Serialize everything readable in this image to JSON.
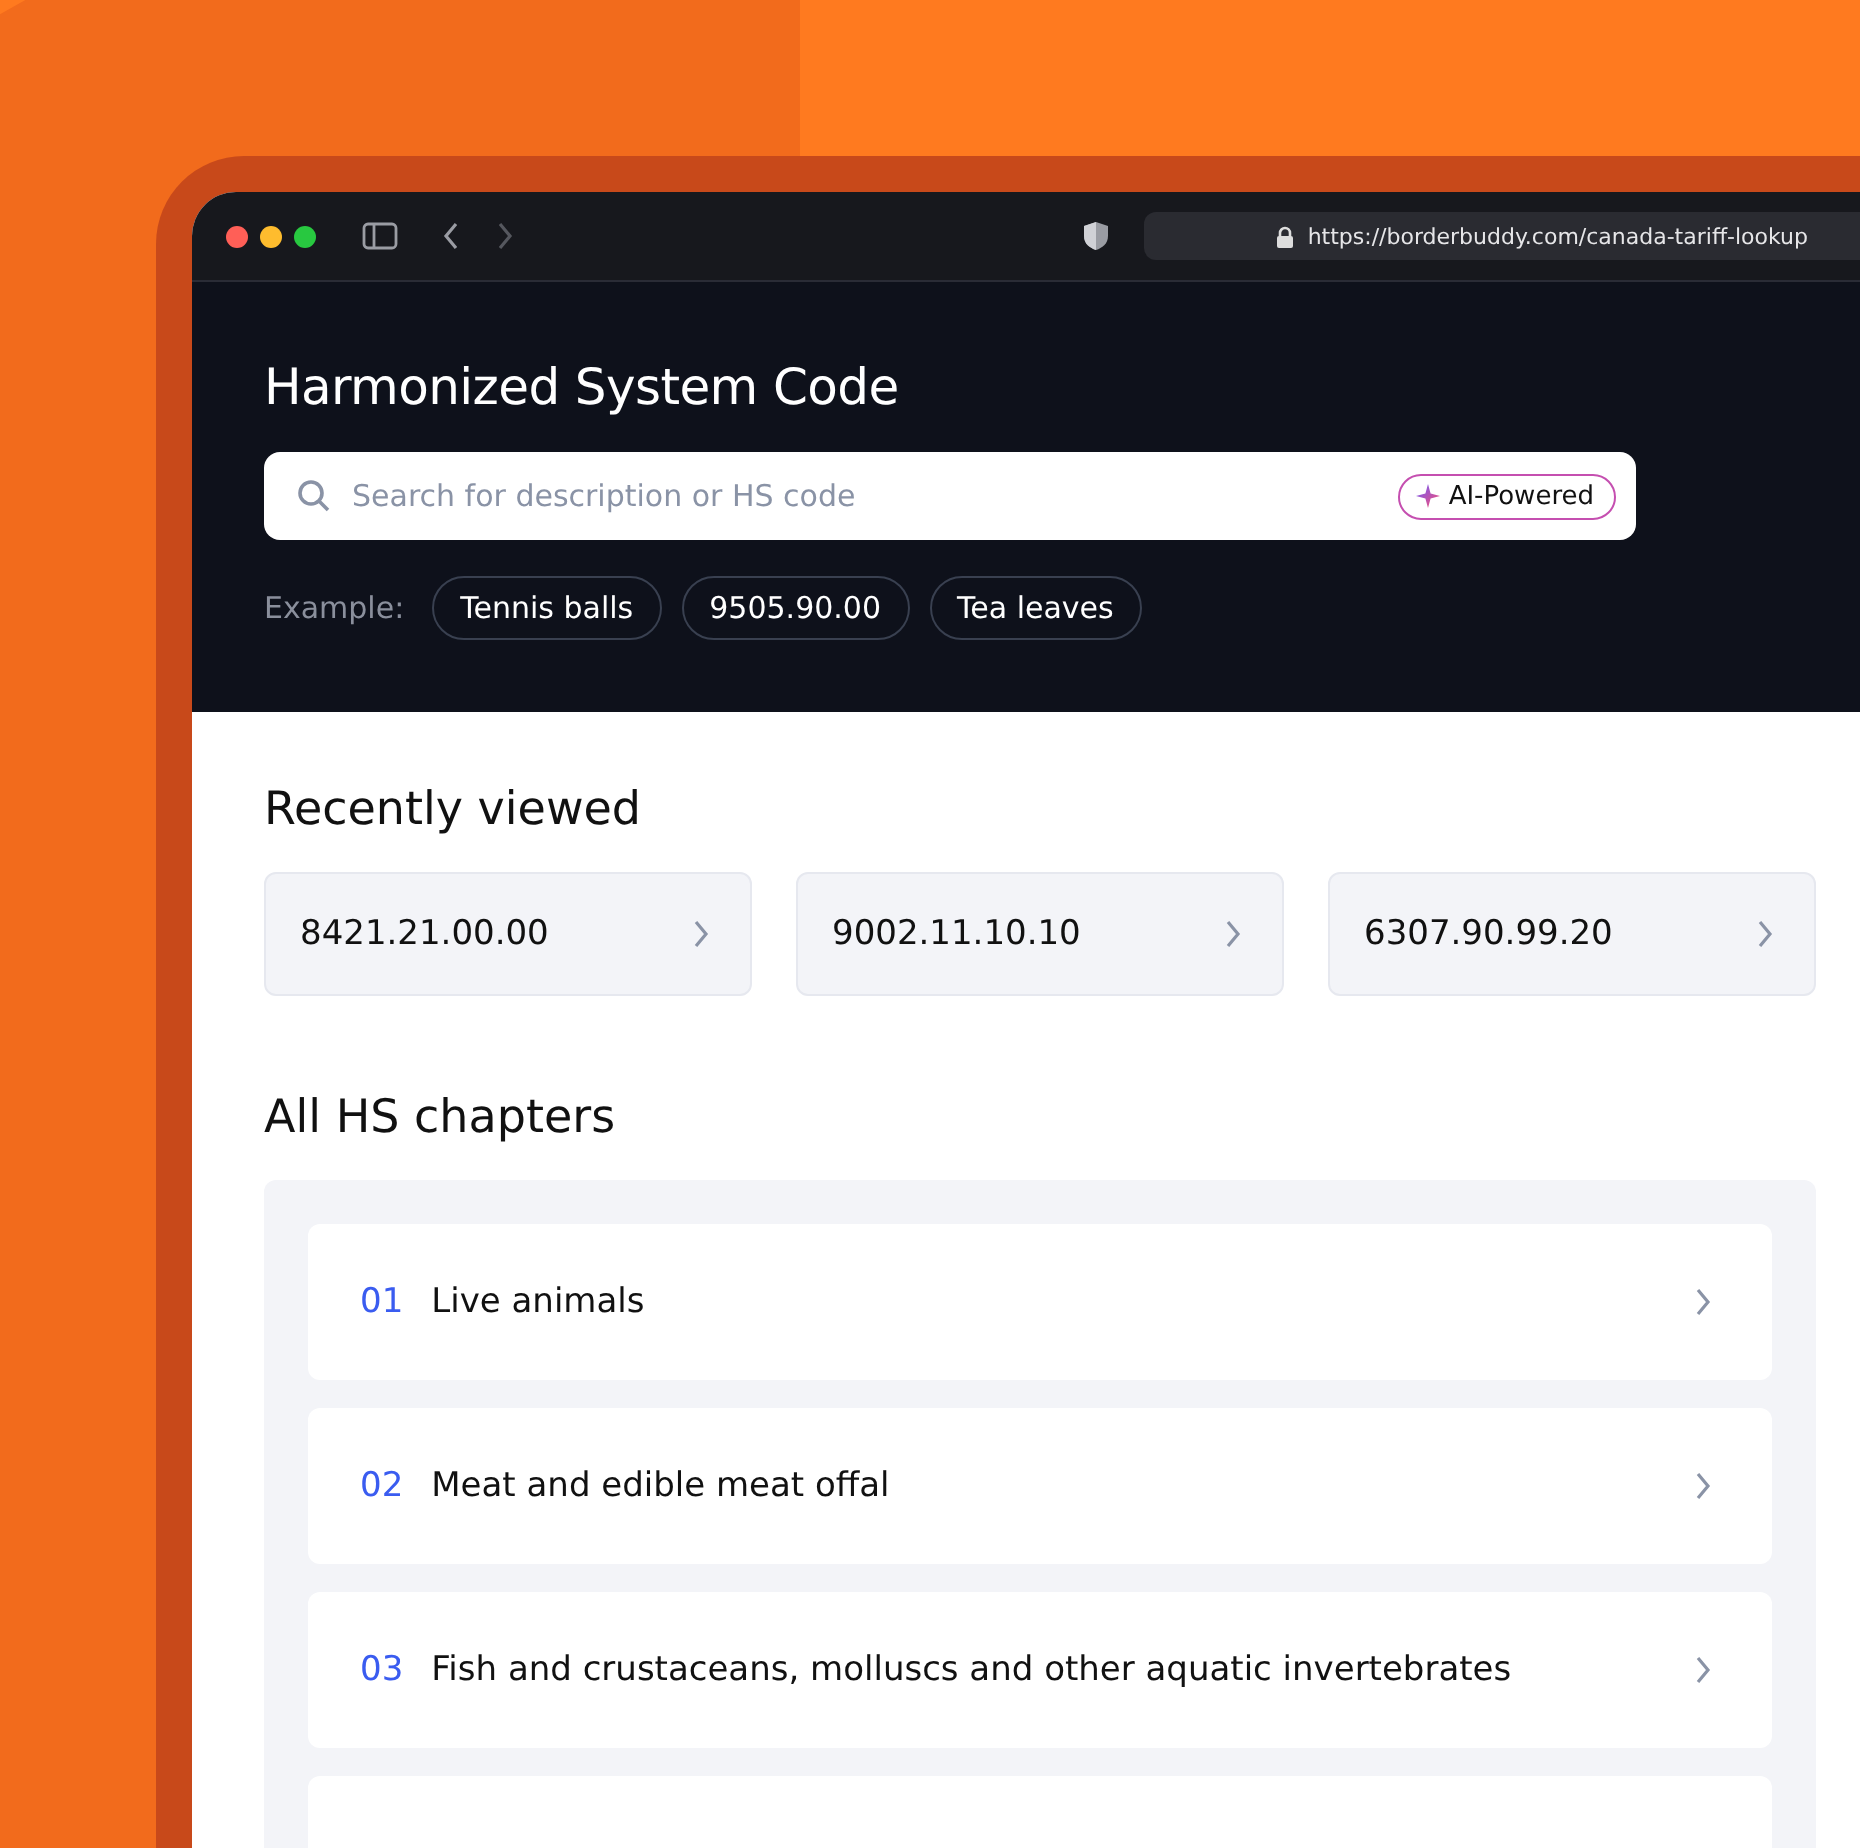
{
  "browser": {
    "url": "https://borderbuddy.com/canada-tariff-lookup"
  },
  "header": {
    "title": "Harmonized System Code",
    "search": {
      "placeholder": "Search for description or HS code"
    },
    "badge": "AI-Powered",
    "examples_label": "Example:",
    "examples": [
      "Tennis balls",
      "9505.90.00",
      "Tea leaves"
    ]
  },
  "recent": {
    "title": "Recently viewed",
    "items": [
      "8421.21.00.00",
      "9002.11.10.10",
      "6307.90.99.20"
    ]
  },
  "chapters": {
    "title": "All HS chapters",
    "items": [
      {
        "number": "01",
        "name": "Live animals"
      },
      {
        "number": "02",
        "name": "Meat and edible meat offal"
      },
      {
        "number": "03",
        "name": "Fish and crustaceans, molluscs and other aquatic invertebrates"
      }
    ]
  }
}
